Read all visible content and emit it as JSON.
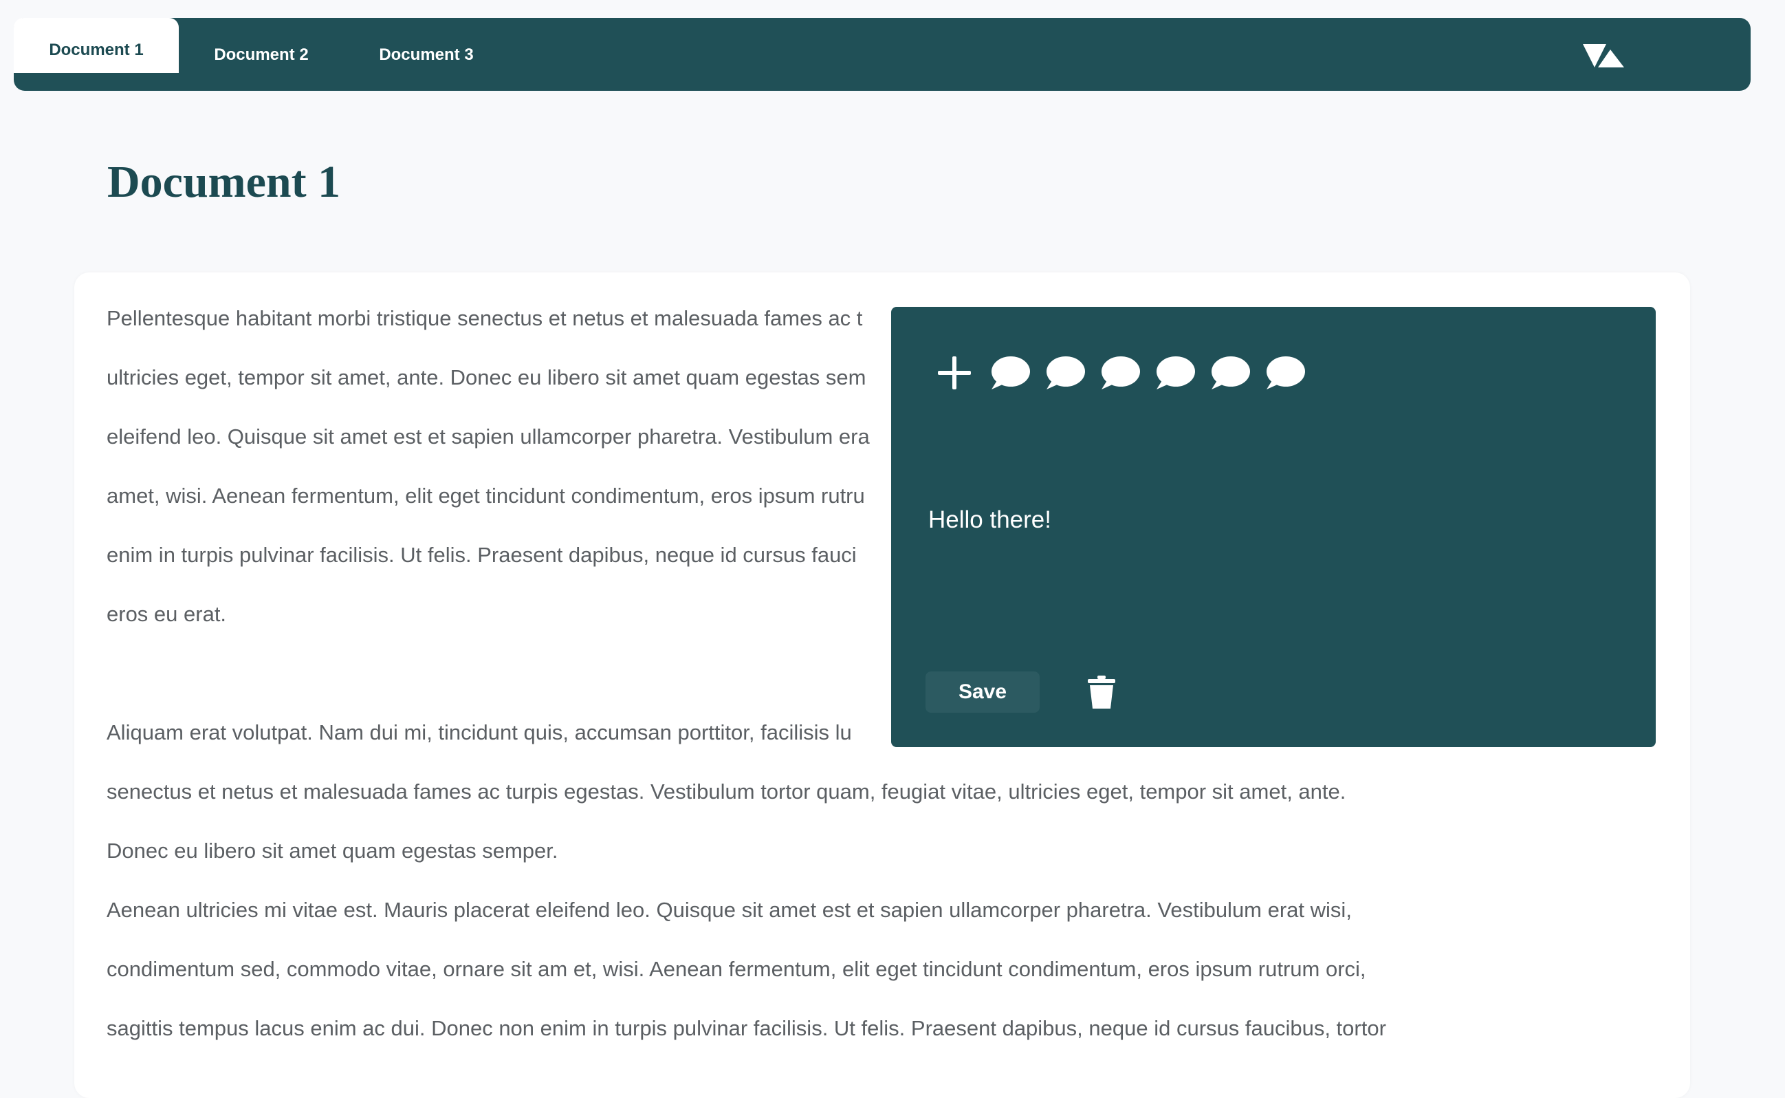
{
  "nav": {
    "tabs": [
      {
        "label": "Document 1",
        "active": true
      },
      {
        "label": "Document 2",
        "active": false
      },
      {
        "label": "Document 3",
        "active": false
      }
    ],
    "logo_icon": "logo-triangles-icon"
  },
  "page": {
    "title": "Document 1"
  },
  "document": {
    "paragraph_1": "Pellentesque habitant morbi tristique senectus et netus et malesuada fames ac t\nultricies eget, tempor sit amet, ante. Donec eu libero sit amet quam egestas sem\neleifend leo. Quisque sit amet est et sapien ullamcorper pharetra. Vestibulum era\namet, wisi. Aenean fermentum, elit eget tincidunt condimentum, eros ipsum rutru\nenim in turpis pulvinar facilisis. Ut felis. Praesent dapibus, neque id cursus fauci\neros eu erat.",
    "paragraph_2": "Aliquam erat volutpat. Nam dui mi, tincidunt quis, accumsan porttitor, facilisis lu\nsenectus et netus et malesuada fames ac turpis egestas. Vestibulum tortor quam, feugiat vitae, ultricies eget, tempor sit amet, ante.\nDonec eu libero sit amet quam egestas semper.\nAenean ultricies mi vitae est. Mauris placerat eleifend leo. Quisque sit amet est et sapien ullamcorper pharetra. Vestibulum erat wisi,\ncondimentum sed, commodo vitae, ornare sit am et, wisi. Aenean fermentum, elit eget tincidunt condimentum, eros ipsum rutrum orci,\nsagittis tempus lacus enim ac dui. Donec non enim in turpis pulvinar facilisis. Ut felis. Praesent dapibus, neque id cursus faucibus, tortor"
  },
  "comment_panel": {
    "icons": [
      "plus-icon",
      "comment-icon",
      "comment-icon",
      "comment-icon",
      "comment-icon",
      "comment-icon",
      "comment-icon"
    ],
    "text": "Hello there!",
    "save_label": "Save",
    "delete_icon": "trash-icon"
  },
  "colors": {
    "brand": "#205057",
    "title": "#1c4a51",
    "body_text": "#5b5f63",
    "background": "#f8f9fb"
  }
}
